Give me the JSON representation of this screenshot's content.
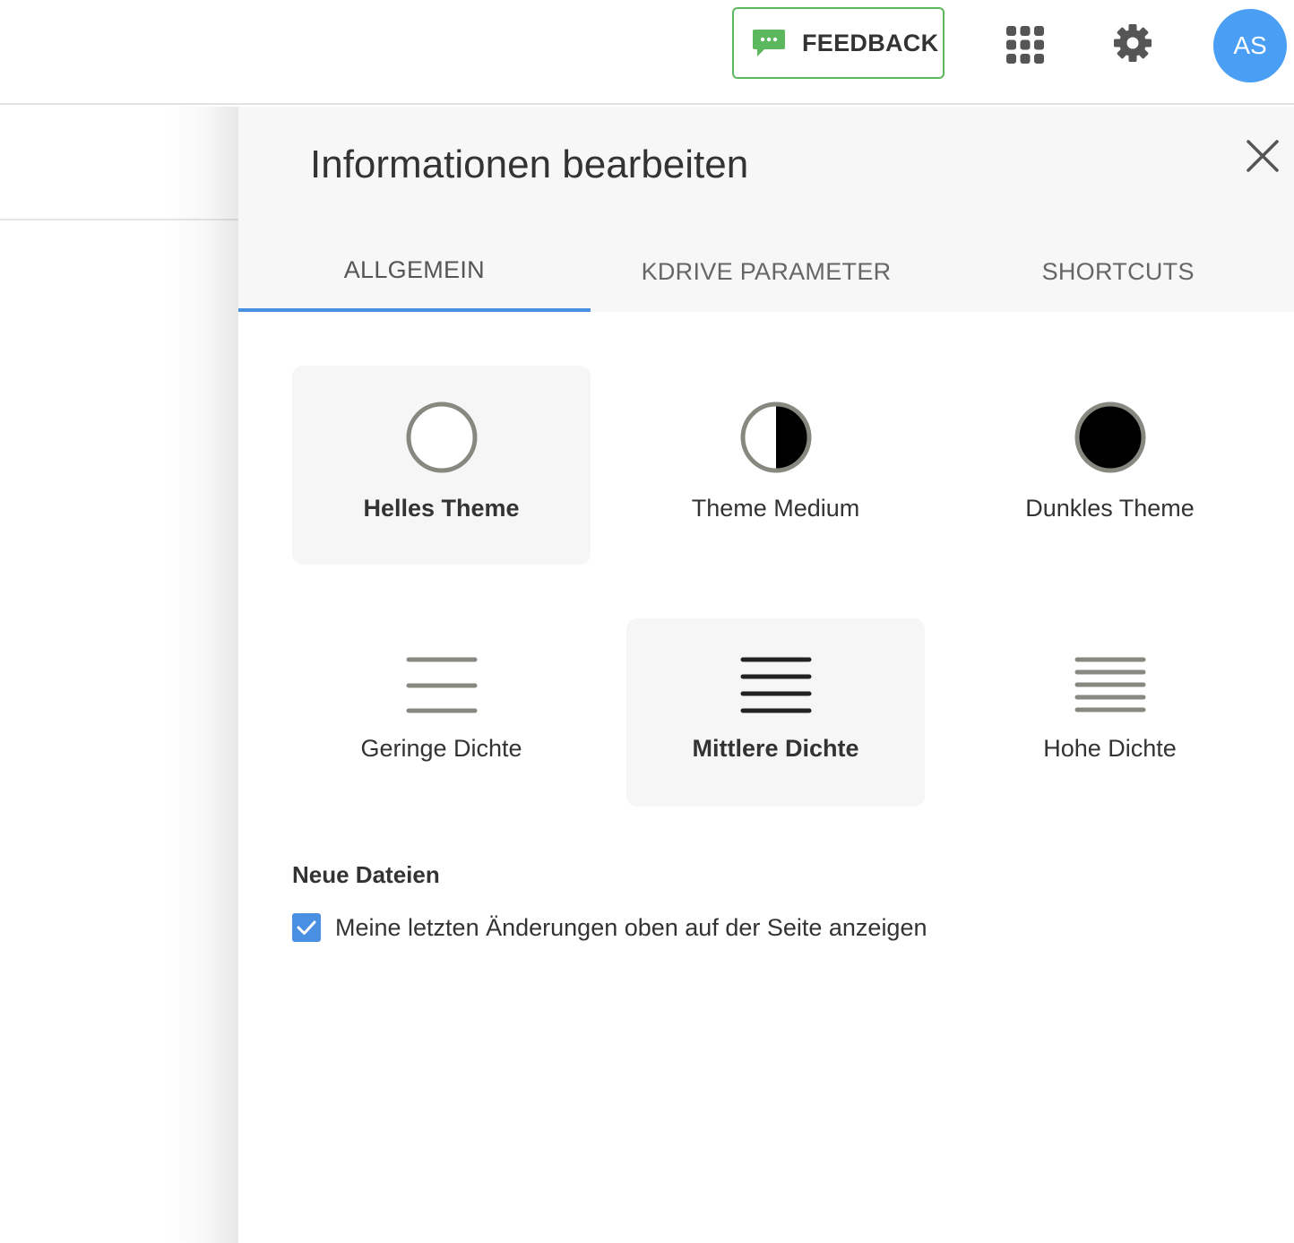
{
  "topbar": {
    "feedback_label": "FEEDBACK",
    "apps_icon": "apps-grid-icon",
    "settings_icon": "gear-icon",
    "avatar_initials": "AS",
    "accent_color": "#4a9ff5",
    "feedback_color": "#5cb85c"
  },
  "panel": {
    "title": "Informationen bearbeiten",
    "tabs": [
      {
        "label": "ALLGEMEIN",
        "active": true
      },
      {
        "label": "KDRIVE PARAMETER",
        "active": false
      },
      {
        "label": "SHORTCUTS",
        "active": false
      }
    ],
    "themes": [
      {
        "label": "Helles Theme",
        "selected": true
      },
      {
        "label": "Theme Medium",
        "selected": false
      },
      {
        "label": "Dunkles Theme",
        "selected": false
      }
    ],
    "densities": [
      {
        "label": "Geringe Dichte",
        "selected": false
      },
      {
        "label": "Mittlere Dichte",
        "selected": true
      },
      {
        "label": "Hohe Dichte",
        "selected": false
      }
    ],
    "new_files": {
      "title": "Neue Dateien",
      "checkbox_label": "Meine letzten Änderungen oben auf der Seite anzeigen",
      "checked": true
    }
  }
}
